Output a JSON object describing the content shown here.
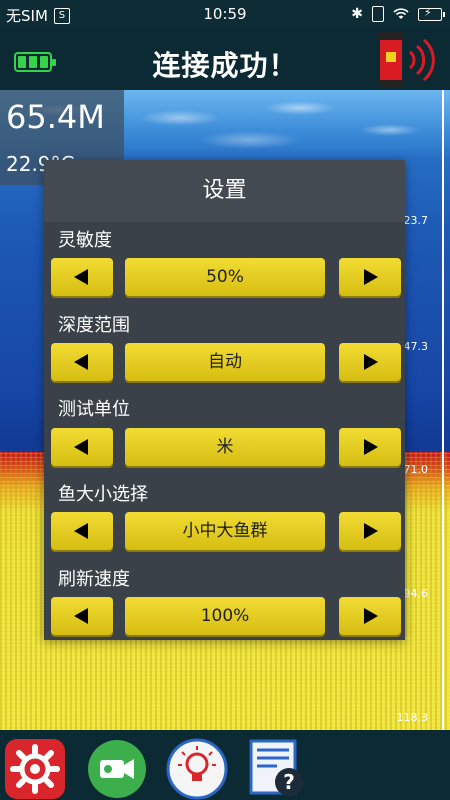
{
  "status_bar": {
    "carrier": "无SIM",
    "sim_icon_label": "S",
    "time": "10:59"
  },
  "header": {
    "title": "连接成功！"
  },
  "sonar": {
    "depth": "65.4M",
    "temperature": "22.9°C",
    "scale_ticks": [
      "23.7",
      "47.3",
      "71.0",
      "94.6",
      "118.3"
    ]
  },
  "settings": {
    "title": "设置",
    "sections": [
      {
        "label": "灵敏度",
        "value": "50%"
      },
      {
        "label": "深度范围",
        "value": "自动"
      },
      {
        "label": "测试单位",
        "value": "米"
      },
      {
        "label": "鱼大小选择",
        "value": "小中大鱼群"
      },
      {
        "label": "刷新速度",
        "value": "100%"
      }
    ]
  },
  "colors": {
    "button_yellow": "#e6cd20",
    "modal_bg": "#3a4149",
    "battery_green": "#37d14a",
    "device_red": "#d91c24"
  },
  "bottom_bar": {
    "icons": [
      "settings-gear-icon",
      "camera-icon",
      "light-bulb-icon",
      "help-manual-icon"
    ]
  }
}
